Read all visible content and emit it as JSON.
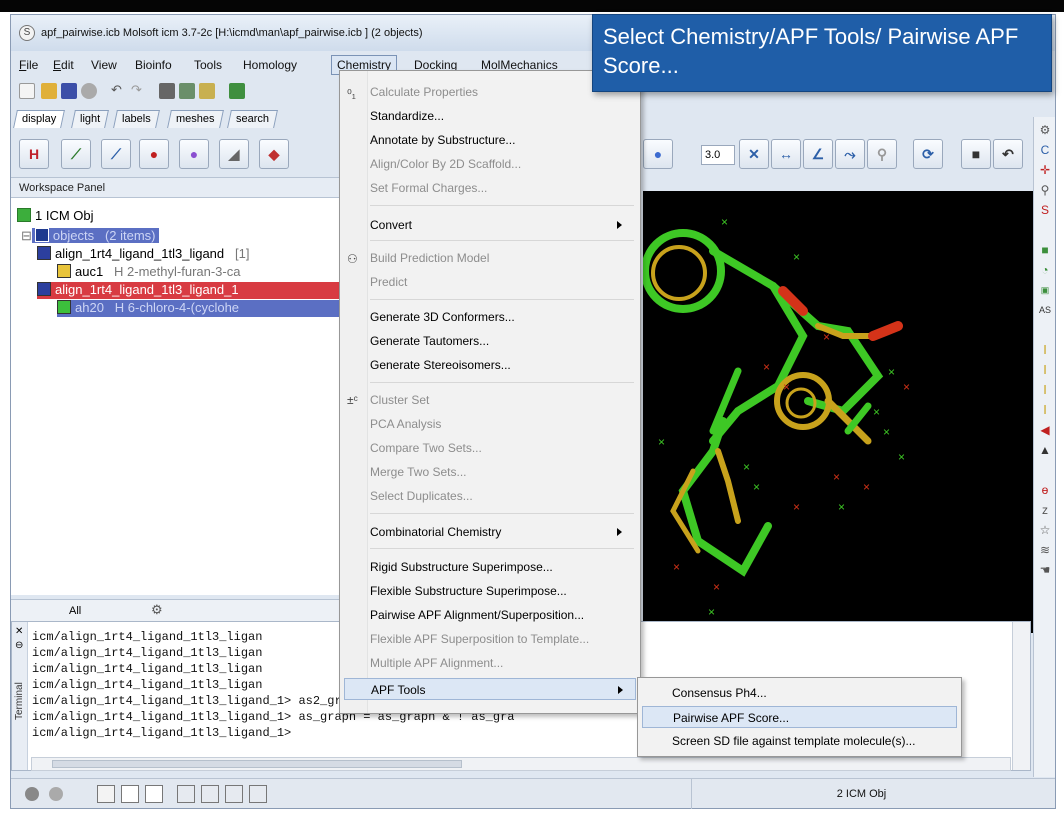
{
  "window": {
    "title": "apf_pairwise.icb Molsoft icm 3.7-2c  [H:\\icmd\\man\\apf_pairwise.icb ] (2 objects)"
  },
  "menubar": {
    "items": [
      {
        "label": "File",
        "key": "F",
        "rest": "ile"
      },
      {
        "label": "Edit",
        "key": "E",
        "rest": "dit"
      },
      {
        "label": "View",
        "key": "",
        "rest": "View"
      },
      {
        "label": "Bioinfo",
        "key": "",
        "rest": "Bioinfo"
      },
      {
        "label": "Tools",
        "key": "",
        "rest": "Tools"
      },
      {
        "label": "Homology",
        "key": "",
        "rest": "Homology"
      },
      {
        "label": "Chemistry",
        "key": "",
        "rest": "Chemistry"
      },
      {
        "label": "Docking",
        "key": "",
        "rest": "Docking"
      },
      {
        "label": "MolMechanics",
        "key": "",
        "rest": "MolMechanics"
      }
    ]
  },
  "tabs": [
    "display",
    "light",
    "labels",
    "meshes",
    "search"
  ],
  "workspace": {
    "header": "Workspace Panel",
    "root": "1 ICM Obj",
    "objects_label": "objects",
    "objects_count": "(2 items)",
    "item1": "align_1rt4_ligand_1tl3_ligand",
    "item1_count": "[1]",
    "item1_child_name": "auc1",
    "item1_child_desc": "H  2-methyl-furan-3-ca",
    "item2": "align_1rt4_ligand_1tl3_ligand_1",
    "item2_child_name": "ah20",
    "item2_child_desc": "H  6-chloro-4-(cyclohe"
  },
  "bottom_tabs": {
    "all": "All"
  },
  "terminal": {
    "label": "Terminal",
    "lines": [
      "icm/align_1rt4_ligand_1tl3_ligan",
      "icm/align_1rt4_ligand_1tl3_ligan",
      "icm/align_1rt4_ligand_1tl3_ligan",
      "icm/align_1rt4_ligand_1tl3_ligan",
      "icm/align_1rt4_ligand_1tl3_ligand_1> as2_graph = as_graph",
      "icm/align_1rt4_ligand_1tl3_ligand_1> as_graph = as_graph & ! as_gra",
      "icm/align_1rt4_ligand_1tl3_ligand_1> "
    ]
  },
  "status": {
    "objects": "2 ICM Obj"
  },
  "viewer_toolbar": {
    "value": "3.0"
  },
  "chemistry_menu": {
    "items": [
      {
        "label": "Calculate Properties",
        "disabled": true
      },
      {
        "label": "Standardize...",
        "disabled": false
      },
      {
        "label": "Annotate by Substructure...",
        "disabled": false
      },
      {
        "label": "Align/Color By 2D Scaffold...",
        "disabled": true
      },
      {
        "label": "Set Formal Charges...",
        "disabled": true
      },
      {
        "label": "Convert",
        "disabled": false
      },
      {
        "label": "Build Prediction Model",
        "disabled": true
      },
      {
        "label": "Predict",
        "disabled": true
      },
      {
        "label": "Generate 3D Conformers...",
        "disabled": false
      },
      {
        "label": "Generate Tautomers...",
        "disabled": false
      },
      {
        "label": "Generate Stereoisomers...",
        "disabled": false
      },
      {
        "label": "Cluster Set",
        "disabled": true
      },
      {
        "label": "PCA Analysis",
        "disabled": true
      },
      {
        "label": "Compare Two Sets...",
        "disabled": true
      },
      {
        "label": "Merge Two Sets...",
        "disabled": true
      },
      {
        "label": "Select Duplicates...",
        "disabled": true
      },
      {
        "label": "Combinatorial Chemistry",
        "disabled": false
      },
      {
        "label": "Rigid Substructure Superimpose...",
        "disabled": false
      },
      {
        "label": "Flexible Substructure Superimpose...",
        "disabled": false
      },
      {
        "label": "Pairwise APF Alignment/Superposition...",
        "disabled": false
      },
      {
        "label": "Flexible APF Superposition to Template...",
        "disabled": true
      },
      {
        "label": "Multiple APF Alignment...",
        "disabled": true
      },
      {
        "label": "APF Tools",
        "disabled": false
      }
    ]
  },
  "apf_submenu": {
    "items": [
      "Consensus Ph4...",
      "Pairwise APF Score...",
      "Screen SD file against template molecule(s)..."
    ]
  },
  "callout": {
    "text": "Select Chemistry/APF Tools/ Pairwise APF Score..."
  },
  "colors": {
    "callout_bg": "#1f5ea8",
    "selection": "#5b6fc3",
    "red_selection": "#d83b42",
    "ligand_green": "#3ec825",
    "ligand_red": "#d43319",
    "ligand_gold": "#c8a21c"
  }
}
